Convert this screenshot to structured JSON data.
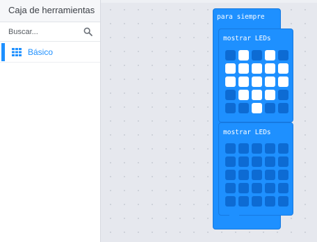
{
  "toolbox": {
    "title": "Caja de herramientas",
    "search_placeholder": "Buscar...",
    "categories": [
      {
        "label": "Básico",
        "color": "#1e90ff",
        "icon": "grid-icon"
      }
    ]
  },
  "workspace": {
    "forever_block": {
      "label": "para siempre",
      "color": "#1e90ff"
    },
    "show_leds": [
      {
        "label": "mostrar LEDs",
        "leds": [
          [
            0,
            1,
            0,
            1,
            0
          ],
          [
            1,
            1,
            1,
            1,
            1
          ],
          [
            1,
            1,
            1,
            1,
            1
          ],
          [
            0,
            1,
            1,
            1,
            0
          ],
          [
            0,
            0,
            1,
            0,
            0
          ]
        ]
      },
      {
        "label": "mostrar LEDs",
        "leds": [
          [
            0,
            0,
            0,
            0,
            0
          ],
          [
            0,
            0,
            0,
            0,
            0
          ],
          [
            0,
            0,
            0,
            0,
            0
          ],
          [
            0,
            0,
            0,
            0,
            0
          ],
          [
            0,
            0,
            0,
            0,
            0
          ]
        ]
      }
    ]
  }
}
